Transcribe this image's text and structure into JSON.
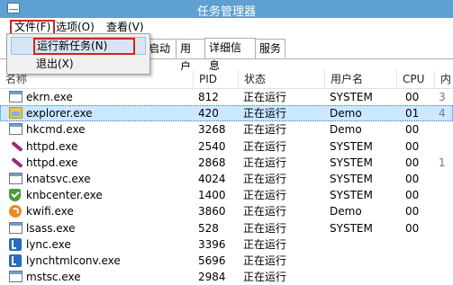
{
  "window": {
    "title": "任务管理器"
  },
  "menubar": {
    "file": "文件(F)",
    "options": "选项(O)",
    "view": "查看(V)"
  },
  "file_menu": {
    "run_new_task": "运行新任务(N)",
    "exit": "退出(X)"
  },
  "tabs": {
    "startup_partial": "启动",
    "users": "用户",
    "details": "详细信息",
    "services": "服务"
  },
  "columns": {
    "name": "名称",
    "pid": "PID",
    "status": "状态",
    "user": "用户名",
    "cpu": "CPU",
    "memory": "内"
  },
  "processes": [
    {
      "icon": "window-icon",
      "name": "ekrn.exe",
      "pid": "812",
      "status": "正在运行",
      "user": "SYSTEM",
      "cpu": "00",
      "mem": "3"
    },
    {
      "icon": "explorer-folder-icon",
      "name": "explorer.exe",
      "pid": "420",
      "status": "正在运行",
      "user": "Demo",
      "cpu": "01",
      "mem": "4",
      "selected": true
    },
    {
      "icon": "window-icon",
      "name": "hkcmd.exe",
      "pid": "3268",
      "status": "正在运行",
      "user": "Demo",
      "cpu": "00",
      "mem": ""
    },
    {
      "icon": "apache-feather-icon",
      "name": "httpd.exe",
      "pid": "2540",
      "status": "正在运行",
      "user": "SYSTEM",
      "cpu": "00",
      "mem": ""
    },
    {
      "icon": "apache-feather-icon",
      "name": "httpd.exe",
      "pid": "2868",
      "status": "正在运行",
      "user": "SYSTEM",
      "cpu": "00",
      "mem": "1"
    },
    {
      "icon": "window-icon",
      "name": "knatsvc.exe",
      "pid": "4024",
      "status": "正在运行",
      "user": "SYSTEM",
      "cpu": "00",
      "mem": ""
    },
    {
      "icon": "green-shield-icon",
      "name": "knbcenter.exe",
      "pid": "1400",
      "status": "正在运行",
      "user": "SYSTEM",
      "cpu": "00",
      "mem": ""
    },
    {
      "icon": "wifi-icon",
      "name": "kwifi.exe",
      "pid": "3860",
      "status": "正在运行",
      "user": "Demo",
      "cpu": "00",
      "mem": ""
    },
    {
      "icon": "window-icon",
      "name": "lsass.exe",
      "pid": "528",
      "status": "正在运行",
      "user": "SYSTEM",
      "cpu": "00",
      "mem": ""
    },
    {
      "icon": "lync-icon",
      "name": "lync.exe",
      "pid": "3396",
      "status": "正在运行",
      "user": "",
      "cpu": "",
      "mem": ""
    },
    {
      "icon": "lync-icon",
      "name": "lynchtmlconv.exe",
      "pid": "5696",
      "status": "正在运行",
      "user": "",
      "cpu": "",
      "mem": ""
    },
    {
      "icon": "window-icon",
      "name": "mstsc.exe",
      "pid": "2984",
      "status": "正在运行",
      "user": "",
      "cpu": "",
      "mem": ""
    }
  ]
}
